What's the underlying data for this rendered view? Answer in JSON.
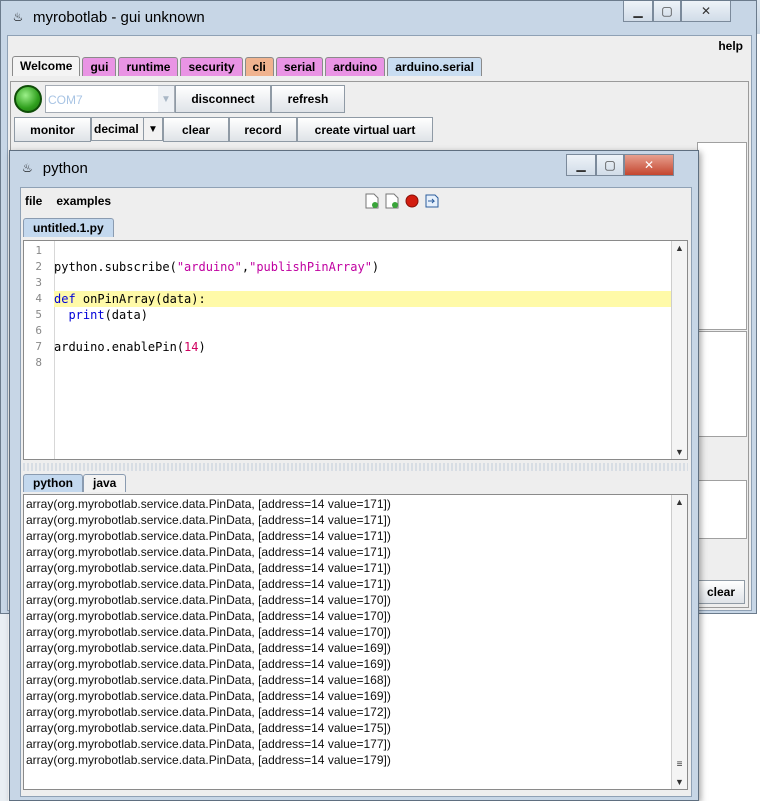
{
  "main_window": {
    "title": "myrobotlab - gui unknown",
    "menu": {
      "help": "help"
    },
    "tabs": [
      {
        "label": "Welcome",
        "color": "#f4f4f4"
      },
      {
        "label": "gui",
        "color": "#e994e4"
      },
      {
        "label": "runtime",
        "color": "#e994e4"
      },
      {
        "label": "security",
        "color": "#e994e4"
      },
      {
        "label": "cli",
        "color": "#f0b38f"
      },
      {
        "label": "serial",
        "color": "#e994e4"
      },
      {
        "label": "arduino",
        "color": "#e994e4"
      },
      {
        "label": "arduino.serial",
        "color": "#c9ddf1"
      }
    ],
    "port_combo": {
      "value": "COM7"
    },
    "buttons": {
      "disconnect": "disconnect",
      "refresh": "refresh",
      "monitor": "monitor",
      "clear": "clear",
      "record": "record",
      "create_virtual_uart": "create virtual uart",
      "clear_bottom": "clear"
    },
    "format_select": {
      "value": "decimal"
    }
  },
  "python_window": {
    "title": "python",
    "menu": {
      "file": "file",
      "examples": "examples"
    },
    "toolbar_icons": [
      "new-file-icon",
      "open-file-icon",
      "stop-icon",
      "execute-icon"
    ],
    "editor_tab": "untitled.1.py",
    "code_lines": [
      {
        "num": "1",
        "text": ""
      },
      {
        "num": "2",
        "text": "python.subscribe(\"arduino\",\"publishPinArray\")"
      },
      {
        "num": "3",
        "text": ""
      },
      {
        "num": "4",
        "text": "def onPinArray(data):"
      },
      {
        "num": "5",
        "text": "  print(data)"
      },
      {
        "num": "6",
        "text": ""
      },
      {
        "num": "7",
        "text": "arduino.enablePin(14)"
      },
      {
        "num": "8",
        "text": ""
      }
    ],
    "output_tabs": [
      "python",
      "java"
    ],
    "output_lines": [
      "array(org.myrobotlab.service.data.PinData, [address=14 value=171])",
      "array(org.myrobotlab.service.data.PinData, [address=14 value=171])",
      "array(org.myrobotlab.service.data.PinData, [address=14 value=171])",
      "array(org.myrobotlab.service.data.PinData, [address=14 value=171])",
      "array(org.myrobotlab.service.data.PinData, [address=14 value=171])",
      "array(org.myrobotlab.service.data.PinData, [address=14 value=171])",
      "array(org.myrobotlab.service.data.PinData, [address=14 value=170])",
      "array(org.myrobotlab.service.data.PinData, [address=14 value=170])",
      "array(org.myrobotlab.service.data.PinData, [address=14 value=170])",
      "array(org.myrobotlab.service.data.PinData, [address=14 value=169])",
      "array(org.myrobotlab.service.data.PinData, [address=14 value=169])",
      "array(org.myrobotlab.service.data.PinData, [address=14 value=168])",
      "array(org.myrobotlab.service.data.PinData, [address=14 value=169])",
      "array(org.myrobotlab.service.data.PinData, [address=14 value=172])",
      "array(org.myrobotlab.service.data.PinData, [address=14 value=175])",
      "array(org.myrobotlab.service.data.PinData, [address=14 value=177])",
      "array(org.myrobotlab.service.data.PinData, [address=14 value=179])"
    ]
  },
  "colors": {
    "keyword": "#0000d8",
    "string": "#c000a0",
    "number": "#d00060",
    "highlight_line": "#fffaa8",
    "led": "#2f9f1d"
  }
}
